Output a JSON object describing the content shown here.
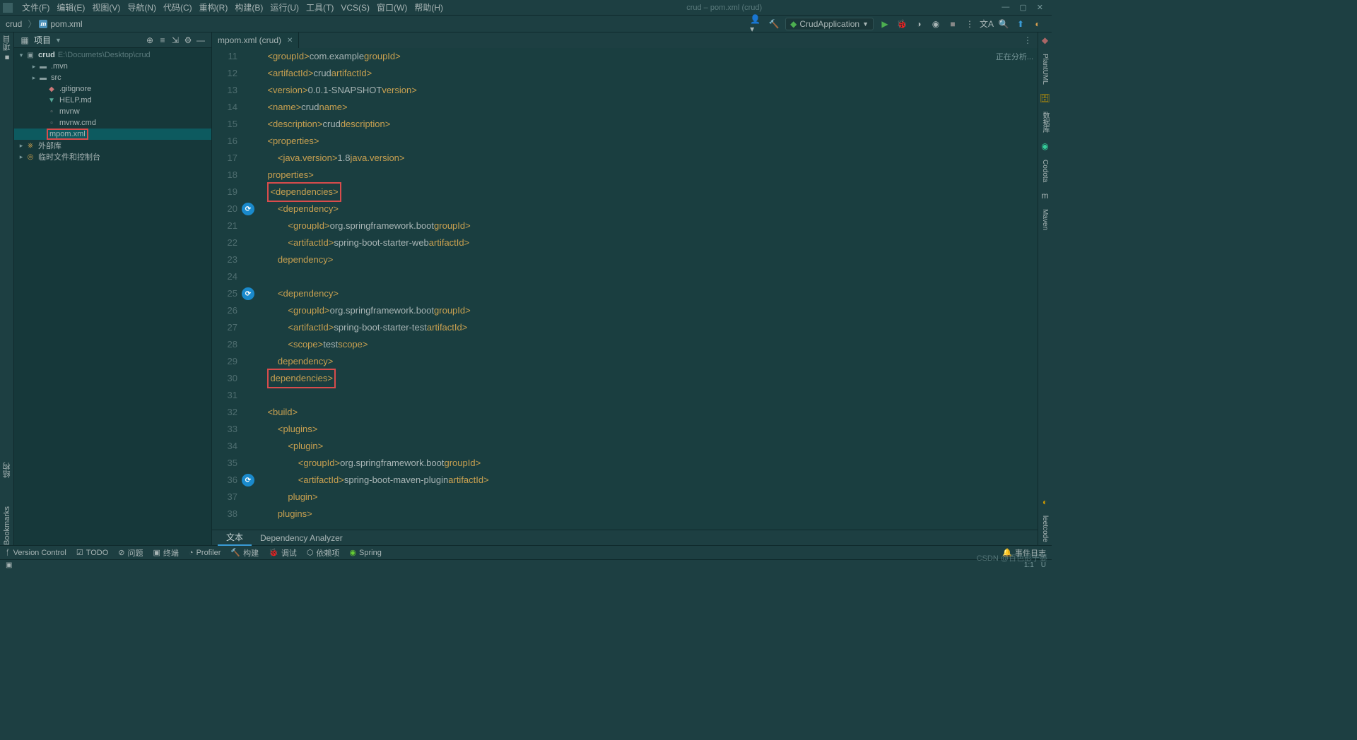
{
  "menu": {
    "items": [
      "文件(F)",
      "编辑(E)",
      "视图(V)",
      "导航(N)",
      "代码(C)",
      "重构(R)",
      "构建(B)",
      "运行(U)",
      "工具(T)",
      "VCS(S)",
      "窗口(W)",
      "帮助(H)"
    ],
    "title": "crud – pom.xml (crud)"
  },
  "win": {
    "min": "—",
    "max": "▢",
    "close": "✕"
  },
  "breadcrumb": {
    "root": "crud",
    "file": "pom.xml"
  },
  "run_config": {
    "label": "CrudApplication"
  },
  "project": {
    "title": "项目",
    "root": {
      "name": "crud",
      "path": "E:\\Documets\\Desktop\\crud"
    },
    "items": [
      ".mvn",
      "src",
      ".gitignore",
      "HELP.md",
      "mvnw",
      "mvnw.cmd",
      "pom.xml"
    ],
    "ext": "外部库",
    "scratch": "临时文件和控制台"
  },
  "left_rails": {
    "structure": "结构",
    "bookmarks": "Bookmarks"
  },
  "tab": {
    "name": "pom.xml (crud)"
  },
  "analysis": "正在分析...",
  "lines": {
    "start": 11,
    "end": 38
  },
  "code": {
    "11": {
      "i": 4,
      "pre": "<",
      "tag": "groupId",
      "mid": ">",
      "txt": "com.example",
      "post": "</",
      "tag2": "groupId",
      "end": ">"
    },
    "12": {
      "i": 4,
      "pre": "<",
      "tag": "artifactId",
      "mid": ">",
      "txt": "crud",
      "post": "</",
      "tag2": "artifactId",
      "end": ">"
    },
    "13": {
      "i": 4,
      "pre": "<",
      "tag": "version",
      "mid": ">",
      "txt": "0.0.1-SNAPSHOT",
      "post": "</",
      "tag2": "version",
      "end": ">"
    },
    "14": {
      "i": 4,
      "pre": "<",
      "tag": "name",
      "mid": ">",
      "txt": "crud",
      "post": "</",
      "tag2": "name",
      "end": ">"
    },
    "15": {
      "i": 4,
      "pre": "<",
      "tag": "description",
      "mid": ">",
      "txt": "crud",
      "post": "</",
      "tag2": "description",
      "end": ">"
    },
    "16": {
      "i": 4,
      "open": "<",
      "tag": "properties",
      "close": ">"
    },
    "17": {
      "i": 8,
      "pre": "<",
      "tag": "java.version",
      "mid": ">",
      "txt": "1.8",
      "post": "</",
      "tag2": "java.version",
      "end": ">"
    },
    "18": {
      "i": 4,
      "open": "</",
      "tag": "properties",
      "close": ">"
    },
    "19": {
      "i": 4,
      "open": "<",
      "tag": "dependencies",
      "close": ">",
      "hl": true
    },
    "20": {
      "i": 8,
      "open": "<",
      "tag": "dependency",
      "close": ">",
      "action": true
    },
    "21": {
      "i": 12,
      "pre": "<",
      "tag": "groupId",
      "mid": ">",
      "txt": "org.springframework.boot",
      "post": "</",
      "tag2": "groupId",
      "end": ">"
    },
    "22": {
      "i": 12,
      "pre": "<",
      "tag": "artifactId",
      "mid": ">",
      "txt": "spring-boot-starter-web",
      "post": "</",
      "tag2": "artifactId",
      "end": ">"
    },
    "23": {
      "i": 8,
      "open": "</",
      "tag": "dependency",
      "close": ">"
    },
    "24": {
      "i": 0,
      "blank": true
    },
    "25": {
      "i": 8,
      "open": "<",
      "tag": "dependency",
      "close": ">",
      "action": true
    },
    "26": {
      "i": 12,
      "pre": "<",
      "tag": "groupId",
      "mid": ">",
      "txt": "org.springframework.boot",
      "post": "</",
      "tag2": "groupId",
      "end": ">"
    },
    "27": {
      "i": 12,
      "pre": "<",
      "tag": "artifactId",
      "mid": ">",
      "txt": "spring-boot-starter-test",
      "post": "</",
      "tag2": "artifactId",
      "end": ">"
    },
    "28": {
      "i": 12,
      "pre": "<",
      "tag": "scope",
      "mid": ">",
      "txt": "test",
      "post": "</",
      "tag2": "scope",
      "end": ">"
    },
    "29": {
      "i": 8,
      "open": "</",
      "tag": "dependency",
      "close": ">"
    },
    "30": {
      "i": 4,
      "open": "</",
      "tag": "dependencies",
      "close": ">",
      "hl": true
    },
    "31": {
      "i": 0,
      "blank": true
    },
    "32": {
      "i": 4,
      "open": "<",
      "tag": "build",
      "close": ">"
    },
    "33": {
      "i": 8,
      "open": "<",
      "tag": "plugins",
      "close": ">"
    },
    "34": {
      "i": 12,
      "open": "<",
      "tag": "plugin",
      "close": ">"
    },
    "35": {
      "i": 16,
      "pre": "<",
      "tag": "groupId",
      "mid": ">",
      "txt": "org.springframework.boot",
      "post": "</",
      "tag2": "groupId",
      "end": ">"
    },
    "36": {
      "i": 16,
      "pre": "<",
      "tag": "artifactId",
      "mid": ">",
      "txt": "spring-boot-maven-plugin",
      "post": "</",
      "tag2": "artifactId",
      "end": ">",
      "action": true
    },
    "37": {
      "i": 12,
      "open": "</",
      "tag": "plugin",
      "close": ">"
    },
    "38": {
      "i": 8,
      "open": "</",
      "tag": "plugins",
      "close": ">"
    }
  },
  "bottom_editor_tabs": {
    "text": "文本",
    "dep": "Dependency Analyzer"
  },
  "toolwin": {
    "vc": "Version Control",
    "todo": "TODO",
    "problems": "问题",
    "terminal": "终端",
    "profiler": "Profiler",
    "build": "构建",
    "debug": "调试",
    "deps": "依赖项",
    "spring": "Spring",
    "events": "事件日志"
  },
  "status": {
    "pos": "1:1",
    "enc": "U"
  },
  "right": {
    "plantuml": "PlantUML",
    "db": "数据库",
    "codota": "Codota",
    "maven": "Maven",
    "leetcode": "leetcode"
  },
  "watermark": "CSDN @百色彭于晏"
}
